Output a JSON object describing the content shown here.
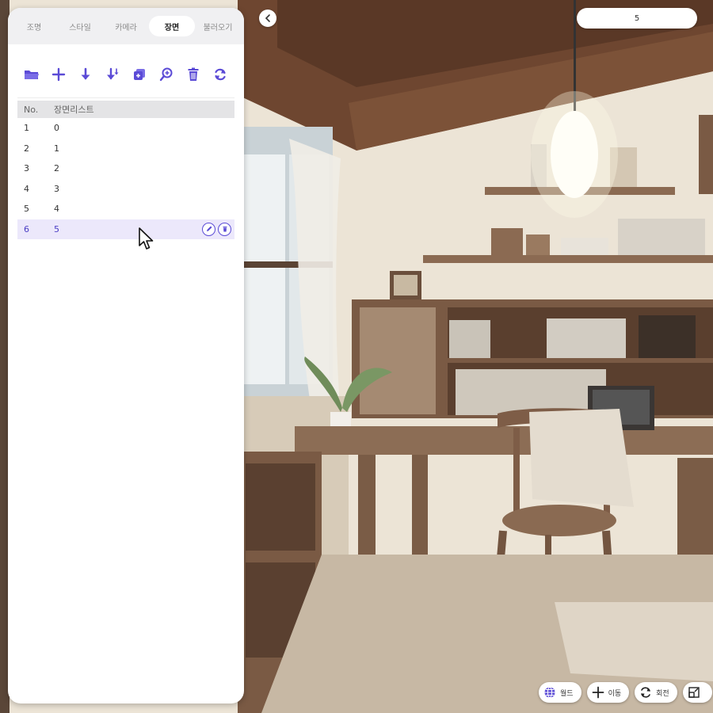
{
  "tabs": [
    {
      "label": "조명",
      "active": false
    },
    {
      "label": "스타일",
      "active": false
    },
    {
      "label": "카메라",
      "active": false
    },
    {
      "label": "장면",
      "active": true
    },
    {
      "label": "불러오기",
      "active": false
    }
  ],
  "toolbar": {
    "icons": [
      "folder-open-icon",
      "plus-icon",
      "arrow-down-icon",
      "arrow-down-double-icon",
      "duplicate-icon",
      "zoom-in-icon",
      "trash-icon",
      "refresh-icon"
    ],
    "accent_color": "#5b4bd6"
  },
  "table": {
    "headers": {
      "no": "No.",
      "name": "장면리스트"
    },
    "rows": [
      {
        "no": "1",
        "name": "0"
      },
      {
        "no": "2",
        "name": "1"
      },
      {
        "no": "3",
        "name": "2"
      },
      {
        "no": "4",
        "name": "3"
      },
      {
        "no": "5",
        "name": "4"
      },
      {
        "no": "6",
        "name": "5",
        "selected": true
      }
    ],
    "row_actions": [
      "edit-icon",
      "delete-icon"
    ]
  },
  "top": {
    "back_icon": "chevron-left-icon",
    "scene_field_value": "5"
  },
  "bottom": {
    "buttons": [
      {
        "icon": "globe-icon",
        "label": "월드"
      },
      {
        "icon": "move-icon",
        "label": "이동"
      },
      {
        "icon": "rotate-icon",
        "label": "회전"
      },
      {
        "icon": "scale-icon",
        "label": ""
      }
    ]
  }
}
